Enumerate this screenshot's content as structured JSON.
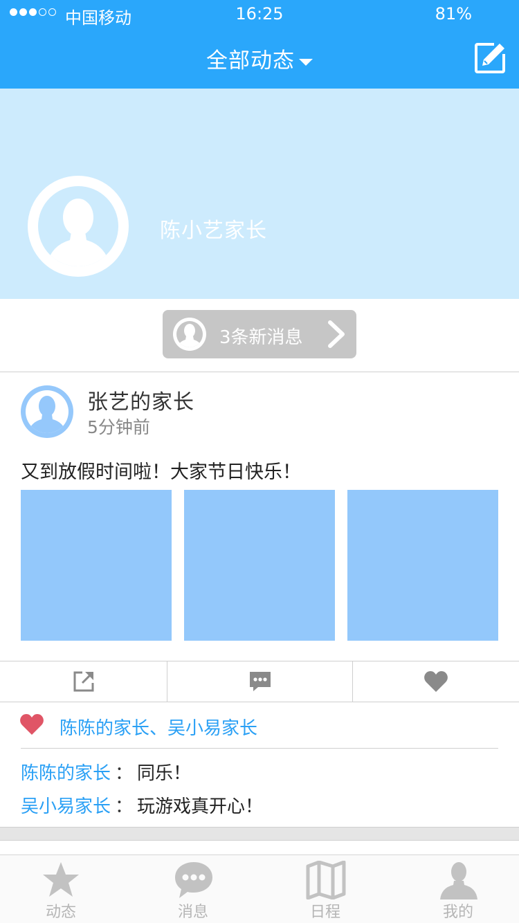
{
  "status_bar": {
    "carrier": "中国移动",
    "time": "16:25",
    "battery": "81%"
  },
  "header": {
    "title": "全部动态",
    "edit_icon": "compose-icon",
    "accent_color": "#2aa7fb"
  },
  "profile": {
    "name": "陈小艺家长",
    "avatar_icon": "person-icon",
    "banner_color": "#cdebfd"
  },
  "new_messages": {
    "label": "3条新消息",
    "icon": "chevron-right-icon"
  },
  "post": {
    "author": "张艺的家长",
    "time": "5分钟前",
    "text": "又到放假时间啦！大家节日快乐！",
    "photo_count": 3,
    "photo_color": "#93c8fb",
    "actions": [
      {
        "icon": "share-icon"
      },
      {
        "icon": "comment-icon"
      },
      {
        "icon": "heart-icon"
      }
    ],
    "likes": "陈陈的家长、吴小易家长",
    "comments": [
      {
        "author": "陈陈的家长",
        "separator": "：",
        "text": "同乐！"
      },
      {
        "author": "吴小易家长",
        "separator": "：",
        "text": "玩游戏真开心！"
      }
    ]
  },
  "tabbar": {
    "tabs": [
      {
        "label": "动态",
        "icon": "star-icon"
      },
      {
        "label": "消息",
        "icon": "chat-bubble-icon"
      },
      {
        "label": "日程",
        "icon": "map-icon"
      },
      {
        "label": "我的",
        "icon": "person-icon"
      }
    ]
  }
}
